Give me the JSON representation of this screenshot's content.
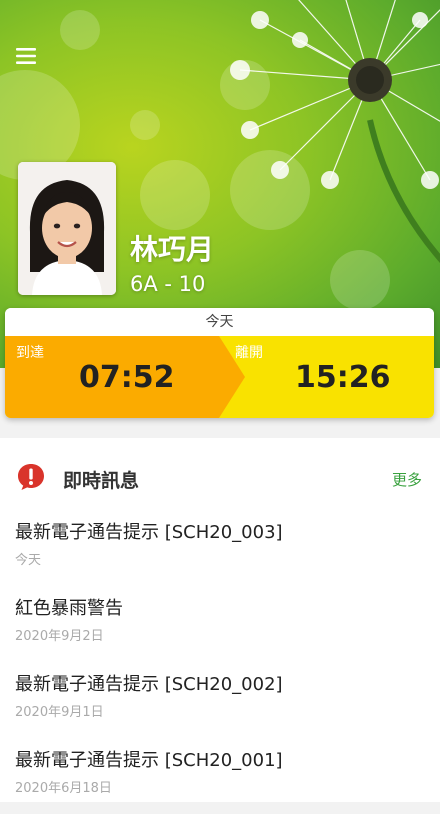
{
  "student": {
    "name": "林巧月",
    "class": "6A - 10"
  },
  "attendance": {
    "date_label": "今天",
    "arrive_label": "到達",
    "arrive_time": "07:52",
    "leave_label": "離開",
    "leave_time": "15:26"
  },
  "news": {
    "title": "即時訊息",
    "more_label": "更多",
    "items": [
      {
        "title": "最新電子通告提示 [SCH20_003]",
        "date": "今天"
      },
      {
        "title": "紅色暴雨警告",
        "date": "2020年9月2日"
      },
      {
        "title": "最新電子通告提示 [SCH20_002]",
        "date": "2020年9月1日"
      },
      {
        "title": "最新電子通告提示 [SCH20_001]",
        "date": "2020年6月18日"
      }
    ]
  },
  "icons": {
    "menu": "hamburger-menu-icon",
    "news": "alert-bubble-icon"
  },
  "colors": {
    "arrive": "#fbab00",
    "leave": "#f9e200",
    "accent": "#3aa13f",
    "alert": "#d9342b"
  }
}
